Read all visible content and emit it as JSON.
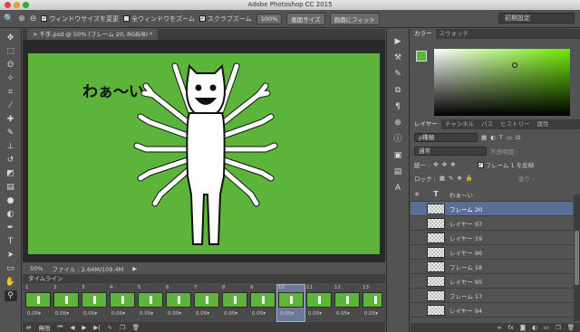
{
  "app": {
    "title": "Adobe Photoshop CC 2015"
  },
  "options": {
    "zoom_tool": "🔍",
    "zoom_in": "⊕",
    "zoom_out": "⊖",
    "resize_windows": "ウィンドウサイズを変更",
    "zoom_all": "全ウィンドウをズーム",
    "scrubby_zoom": "スクラブズーム",
    "zoom_100": "100%",
    "fit_canvas": "画面サイズ",
    "fill_screen": "画面にフィット",
    "workspace": "初期設定"
  },
  "document": {
    "tab_label": "千手.psd @ 50% (フレーム 20, RGB/8) *",
    "text_layer": "わぁ〜い",
    "zoom": "50%",
    "file_info": "ファイル : 2.64M/109.4M"
  },
  "timeline": {
    "title": "タイムライン",
    "loop": "無限",
    "frames": [
      {
        "num": "1",
        "dur": "0.05▾"
      },
      {
        "num": "2",
        "dur": "0.05▾"
      },
      {
        "num": "3",
        "dur": "0.05▾"
      },
      {
        "num": "4",
        "dur": "0.05▾"
      },
      {
        "num": "5",
        "dur": "0.05▾"
      },
      {
        "num": "6",
        "dur": "0.05▾"
      },
      {
        "num": "7",
        "dur": "0.05▾"
      },
      {
        "num": "8",
        "dur": "0.05▾"
      },
      {
        "num": "9",
        "dur": "0.05▾"
      },
      {
        "num": "10",
        "dur": "0.05▾"
      },
      {
        "num": "11",
        "dur": "0.05▾"
      },
      {
        "num": "12",
        "dur": "0.05▾"
      },
      {
        "num": "13",
        "dur": "0.05▾"
      }
    ],
    "selected_frame": "10"
  },
  "color_panel": {
    "tabs": [
      "カラー",
      "スウォッチ"
    ],
    "fg_color": "#5db43a"
  },
  "layers_panel": {
    "tabs": [
      "レイヤー",
      "チャンネル",
      "パス",
      "ヒストリー",
      "属性"
    ],
    "filter": "ρ種類",
    "blend_mode": "通常",
    "opacity_label": "不透明度 :",
    "unify_label": "統一 :",
    "propagate_label": "フレーム 1 を反映",
    "lock_label": "ロック :",
    "fill_label": "塗り :",
    "layers": [
      {
        "name": "わぁ〜い",
        "type": "T"
      },
      {
        "name": "フレーム 20",
        "selected": true
      },
      {
        "name": "レイヤー 97"
      },
      {
        "name": "レイヤー 19"
      },
      {
        "name": "レイヤー 96"
      },
      {
        "name": "フレーム 18"
      },
      {
        "name": "レイヤー 95"
      },
      {
        "name": "フレーム 17"
      },
      {
        "name": "レイヤー 94"
      }
    ]
  }
}
